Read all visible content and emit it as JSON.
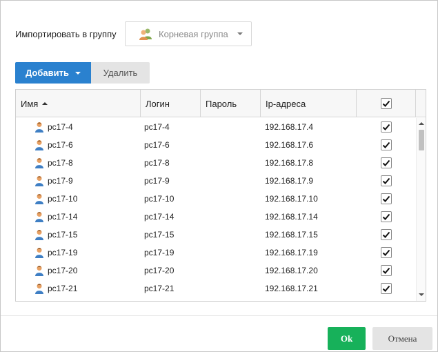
{
  "import": {
    "label": "Импортировать в группу",
    "group_value": "Корневая группа",
    "group_icon": "users-group-icon"
  },
  "toolbar": {
    "add_label": "Добавить",
    "delete_label": "Удалить"
  },
  "grid": {
    "columns": {
      "name": "Имя",
      "login": "Логин",
      "password": "Пароль",
      "ip": "Ip-адреса"
    },
    "rows": [
      {
        "name": "pc17-4",
        "login": "pc17-4",
        "password": "",
        "ip": "192.168.17.4",
        "checked": true
      },
      {
        "name": "pc17-6",
        "login": "pc17-6",
        "password": "",
        "ip": "192.168.17.6",
        "checked": true
      },
      {
        "name": "pc17-8",
        "login": "pc17-8",
        "password": "",
        "ip": "192.168.17.8",
        "checked": true
      },
      {
        "name": "pc17-9",
        "login": "pc17-9",
        "password": "",
        "ip": "192.168.17.9",
        "checked": true
      },
      {
        "name": "pc17-10",
        "login": "pc17-10",
        "password": "",
        "ip": "192.168.17.10",
        "checked": true
      },
      {
        "name": "pc17-14",
        "login": "pc17-14",
        "password": "",
        "ip": "192.168.17.14",
        "checked": true
      },
      {
        "name": "pc17-15",
        "login": "pc17-15",
        "password": "",
        "ip": "192.168.17.15",
        "checked": true
      },
      {
        "name": "pc17-19",
        "login": "pc17-19",
        "password": "",
        "ip": "192.168.17.19",
        "checked": true
      },
      {
        "name": "pc17-20",
        "login": "pc17-20",
        "password": "",
        "ip": "192.168.17.20",
        "checked": true
      },
      {
        "name": "pc17-21",
        "login": "pc17-21",
        "password": "",
        "ip": "192.168.17.21",
        "checked": true
      }
    ]
  },
  "footer": {
    "ok_label": "Ok",
    "cancel_label": "Отмена"
  },
  "colors": {
    "primary": "#2a81cf",
    "ok": "#17b15a",
    "secondary": "#e4e4e4"
  }
}
